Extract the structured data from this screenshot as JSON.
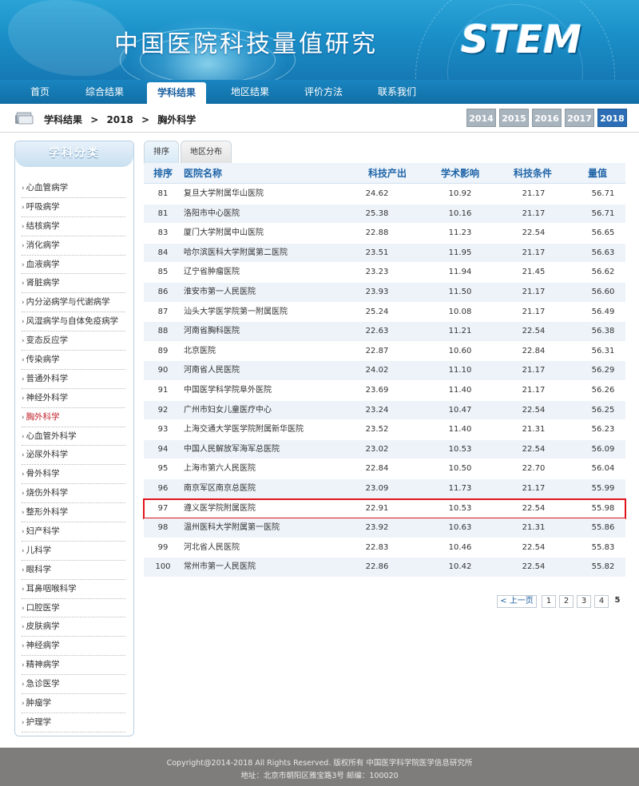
{
  "banner": {
    "title": "中国医院科技量值研究",
    "logo": "STEM"
  },
  "nav": {
    "items": [
      "首页",
      "综合结果",
      "学科结果",
      "地区结果",
      "评价方法",
      "联系我们"
    ],
    "active_index": 2
  },
  "breadcrumb": {
    "parts": [
      "学科结果",
      ">",
      "2018",
      ">",
      "胸外科学"
    ],
    "icon": "folder-icon"
  },
  "years": [
    "2014",
    "2015",
    "2016",
    "2017",
    "2018"
  ],
  "active_year": "2018",
  "sidebar": {
    "title": "学科分类",
    "items": [
      "心血管病学",
      "呼吸病学",
      "结核病学",
      "消化病学",
      "血液病学",
      "肾脏病学",
      "内分泌病学与代谢病学",
      "风湿病学与自体免疫病学",
      "变态反应学",
      "传染病学",
      "普通外科学",
      "神经外科学",
      "胸外科学",
      "心血管外科学",
      "泌尿外科学",
      "骨外科学",
      "烧伤外科学",
      "整形外科学",
      "妇产科学",
      "儿科学",
      "眼科学",
      "耳鼻咽喉科学",
      "口腔医学",
      "皮肤病学",
      "神经病学",
      "精神病学",
      "急诊医学",
      "肿瘤学",
      "护理学"
    ],
    "active_item": "胸外科学"
  },
  "tabs": [
    "排序",
    "地区分布"
  ],
  "table": {
    "headers": [
      "排序",
      "医院名称",
      "科技产出",
      "学术影响",
      "科技条件",
      "量值"
    ],
    "rows": [
      [
        "81",
        "复旦大学附属华山医院",
        "24.62",
        "10.92",
        "21.17",
        "56.71"
      ],
      [
        "81",
        "洛阳市中心医院",
        "25.38",
        "10.16",
        "21.17",
        "56.71"
      ],
      [
        "83",
        "厦门大学附属中山医院",
        "22.88",
        "11.23",
        "22.54",
        "56.65"
      ],
      [
        "84",
        "哈尔滨医科大学附属第二医院",
        "23.51",
        "11.95",
        "21.17",
        "56.63"
      ],
      [
        "85",
        "辽宁省肿瘤医院",
        "23.23",
        "11.94",
        "21.45",
        "56.62"
      ],
      [
        "86",
        "淮安市第一人民医院",
        "23.93",
        "11.50",
        "21.17",
        "56.60"
      ],
      [
        "87",
        "汕头大学医学院第一附属医院",
        "25.24",
        "10.08",
        "21.17",
        "56.49"
      ],
      [
        "88",
        "河南省胸科医院",
        "22.63",
        "11.21",
        "22.54",
        "56.38"
      ],
      [
        "89",
        "北京医院",
        "22.87",
        "10.60",
        "22.84",
        "56.31"
      ],
      [
        "90",
        "河南省人民医院",
        "24.02",
        "11.10",
        "21.17",
        "56.29"
      ],
      [
        "91",
        "中国医学科学院阜外医院",
        "23.69",
        "11.40",
        "21.17",
        "56.26"
      ],
      [
        "92",
        "广州市妇女儿童医疗中心",
        "23.24",
        "10.47",
        "22.54",
        "56.25"
      ],
      [
        "93",
        "上海交通大学医学院附属新华医院",
        "23.52",
        "11.40",
        "21.31",
        "56.23"
      ],
      [
        "94",
        "中国人民解放军海军总医院",
        "23.02",
        "10.53",
        "22.54",
        "56.09"
      ],
      [
        "95",
        "上海市第六人民医院",
        "22.84",
        "10.50",
        "22.70",
        "56.04"
      ],
      [
        "96",
        "南京军区南京总医院",
        "23.09",
        "11.73",
        "21.17",
        "55.99"
      ],
      [
        "97",
        "遵义医学院附属医院",
        "22.91",
        "10.53",
        "22.54",
        "55.98"
      ],
      [
        "98",
        "温州医科大学附属第一医院",
        "23.92",
        "10.63",
        "21.31",
        "55.86"
      ],
      [
        "99",
        "河北省人民医院",
        "22.83",
        "10.46",
        "22.54",
        "55.83"
      ],
      [
        "100",
        "常州市第一人民医院",
        "22.86",
        "10.42",
        "22.54",
        "55.82"
      ]
    ],
    "highlight_row_index": 16
  },
  "pagination": {
    "prev_label": "< 上一页",
    "pages": [
      "1",
      "2",
      "3",
      "4"
    ],
    "current": "5"
  },
  "footer": {
    "line1": "Copyright@2014-2018 All Rights Reserved. 版权所有 中国医学科学院医学信息研究所",
    "line2": "地址：北京市朝阳区雅宝路3号 邮编：100020"
  },
  "colors": {
    "nav_bg": "#1679b4",
    "active_year": "#2b6eb5",
    "header_text": "#1f64a8",
    "highlight": "#e0131a",
    "active_side": "#c0202a",
    "footer_bg": "#7f7d7b"
  }
}
